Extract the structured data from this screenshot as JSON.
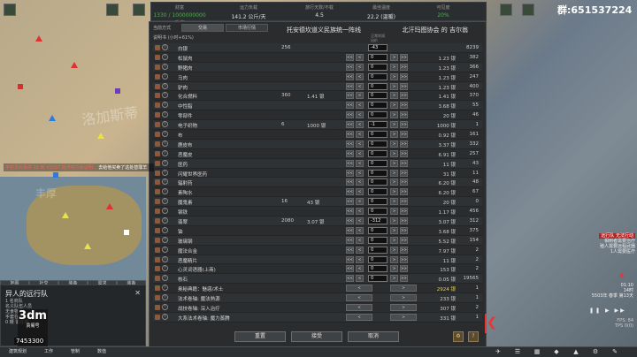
{
  "topbar": {
    "stats": [
      {
        "label": "财富",
        "value": "1330 / 1000000000 千克",
        "green": true
      },
      {
        "label": "运力负载",
        "value": "141.2 公斤/天",
        "green": false
      },
      {
        "label": "旅行天数/不载",
        "value": "4.5",
        "green": false
      },
      {
        "label": "最佳温度",
        "value": "22.2 (温暖)",
        "green": false
      },
      {
        "label": "可见度",
        "value": "20%",
        "green": true
      }
    ]
  },
  "dialog": {
    "trade_label": "当前方式",
    "tabs": [
      "交易",
      "市场行情"
    ],
    "colony": "托安德坎道义民族统一阵线",
    "trader": "北汗玛图协会 的 吉尔翁",
    "rate_label": "说明书 (小时+61%)",
    "cap_top": "正常利润",
    "cap_bottom": "出价",
    "rows": [
      {
        "name": "白银",
        "cq": "256",
        "cp": "",
        "cnt": "-43",
        "tp": "",
        "tq": "8239",
        "buttons": false,
        "silver": true
      },
      {
        "name": "松鼠肉",
        "cq": "",
        "cp": "",
        "cnt": "0",
        "tp": "1.23 银",
        "tq": "382",
        "buttons": true
      },
      {
        "name": "野猪肉",
        "cq": "",
        "cp": "",
        "cnt": "0",
        "tp": "1.23 银",
        "tq": "366",
        "buttons": true
      },
      {
        "name": "马肉",
        "cq": "",
        "cp": "",
        "cnt": "0",
        "tp": "1.23 银",
        "tq": "247",
        "buttons": true
      },
      {
        "name": "驴肉",
        "cq": "",
        "cp": "",
        "cnt": "0",
        "tp": "1.23 银",
        "tq": "400",
        "buttons": true
      },
      {
        "name": "化合燃料",
        "cq": "360",
        "cp": "1.41 银",
        "cnt": "0",
        "tp": "1.41 银",
        "tq": "370",
        "buttons": true
      },
      {
        "name": "中性脂",
        "cq": "",
        "cp": "",
        "cnt": "0",
        "tp": "3.68 银",
        "tq": "55",
        "buttons": true
      },
      {
        "name": "零部件",
        "cq": "",
        "cp": "",
        "cnt": "0",
        "tp": "20 银",
        "tq": "46",
        "buttons": true
      },
      {
        "name": "电子织物",
        "cq": "6",
        "cp": "1000 银",
        "cnt": "-1",
        "tp": "1000 银",
        "tq": "1",
        "buttons": true
      },
      {
        "name": "布",
        "cq": "",
        "cp": "",
        "cnt": "0",
        "tp": "0.92 银",
        "tq": "161",
        "buttons": true
      },
      {
        "name": "鹿皮布",
        "cq": "",
        "cp": "",
        "cnt": "0",
        "tp": "3.37 银",
        "tq": "332",
        "buttons": true
      },
      {
        "name": "恶魔皮",
        "cq": "",
        "cp": "",
        "cnt": "0",
        "tp": "6.91 银",
        "tq": "257",
        "buttons": true
      },
      {
        "name": "医药",
        "cq": "",
        "cp": "",
        "cnt": "0",
        "tp": "11 银",
        "tq": "43",
        "buttons": true
      },
      {
        "name": "闪耀世界医药",
        "cq": "",
        "cp": "",
        "cnt": "0",
        "tp": "31 银",
        "tq": "11",
        "buttons": true
      },
      {
        "name": "辐射药",
        "cq": "",
        "cp": "",
        "cnt": "0",
        "tp": "6.20 银",
        "tq": "48",
        "buttons": true
      },
      {
        "name": "素陶水",
        "cq": "",
        "cp": "",
        "cnt": "0",
        "tp": "6.20 银",
        "tq": "67",
        "buttons": true
      },
      {
        "name": "魔鬼素",
        "cq": "16",
        "cp": "43 银",
        "cnt": "0",
        "tp": "20 银",
        "tq": "0",
        "buttons": true
      },
      {
        "name": "钢铁",
        "cq": "",
        "cp": "",
        "cnt": "0",
        "tp": "1.17 银",
        "tq": "456",
        "buttons": true
      },
      {
        "name": "翡翠",
        "cq": "2080",
        "cp": "3.07 银",
        "cnt": "-312",
        "tp": "3.07 银",
        "tq": "312",
        "buttons": true
      },
      {
        "name": "铀",
        "cq": "",
        "cp": "",
        "cnt": "0",
        "tp": "3.68 银",
        "tq": "375",
        "buttons": true
      },
      {
        "name": "玻璃钢",
        "cq": "",
        "cp": "",
        "cnt": "0",
        "tp": "5.52 银",
        "tq": "154",
        "buttons": true
      },
      {
        "name": "魔法合金",
        "cq": "",
        "cp": "",
        "cnt": "0",
        "tp": "7.97 银",
        "tq": "2",
        "buttons": true
      },
      {
        "name": "恶魔精片",
        "cq": "",
        "cp": "",
        "cnt": "0",
        "tp": "11 银",
        "tq": "2",
        "buttons": true
      },
      {
        "name": "心灵词语器(上商)",
        "cq": "",
        "cp": "",
        "cnt": "0",
        "tp": "153 银",
        "tq": "2",
        "buttons": true
      },
      {
        "name": "核石",
        "cq": "",
        "cp": "",
        "cnt": "0",
        "tp": "0.05 银",
        "tq": "19565",
        "buttons": true
      },
      {
        "name": "奥秘典籍：魅惑/术士",
        "cq": "",
        "cp": "",
        "cnt": "",
        "tp": "2924 银",
        "tq": "1",
        "buttons": false,
        "single": true,
        "warn": true
      },
      {
        "name": "法术卷轴: 魔法熟源",
        "cq": "",
        "cp": "",
        "cnt": "",
        "tp": "233 银",
        "tq": "1",
        "buttons": false,
        "single": true
      },
      {
        "name": "战技卷轴: 深入治疗",
        "cq": "",
        "cp": "",
        "cnt": "",
        "tp": "307 银",
        "tq": "2",
        "buttons": false,
        "single": true
      },
      {
        "name": "大系法术卷轴: 魔力蒸腾",
        "cq": "",
        "cp": "",
        "cnt": "",
        "tp": "331 银",
        "tq": "1",
        "buttons": false,
        "single": true
      }
    ],
    "buttons": {
      "reset": "重置",
      "accept": "接受",
      "cancel": "取消",
      "help": "?"
    }
  },
  "map_labels": [
    "洛加斯蒂",
    "丰厚"
  ],
  "letter": {
    "red_text": "宇航员的事件 16 到 V2037 经济权力会议明...",
    "rest_text": "去给他买卖了这处替罪羊"
  },
  "caravan": {
    "title": "异人的远行队",
    "lines": [
      "1 名商队",
      "名义队伍人员",
      "无食物",
      "手套在此",
      "0 鞭 需在载"
    ],
    "tabs": [
      "地图",
      "社交",
      "装备",
      "需求",
      "装备"
    ]
  },
  "watermark": {
    "big": "3dm",
    "small": "贵阁号",
    "num": "7453300"
  },
  "bottom_strip": [
    "建筑规划",
    "工作",
    "管制",
    "数值"
  ],
  "right": {
    "qq": "群:651537224",
    "alerts": [
      "远行队 无法行动",
      "相到者需要治疗",
      "殖人需要远程武器",
      "1人需要医疗"
    ],
    "clock": [
      "01:10",
      "14时",
      "5503年 春季 第13天"
    ],
    "fps": [
      "FPS: 84",
      "TPS 0(0)"
    ]
  },
  "colors": {
    "accent_green": "#4caf50",
    "alert_red": "#b22222"
  }
}
